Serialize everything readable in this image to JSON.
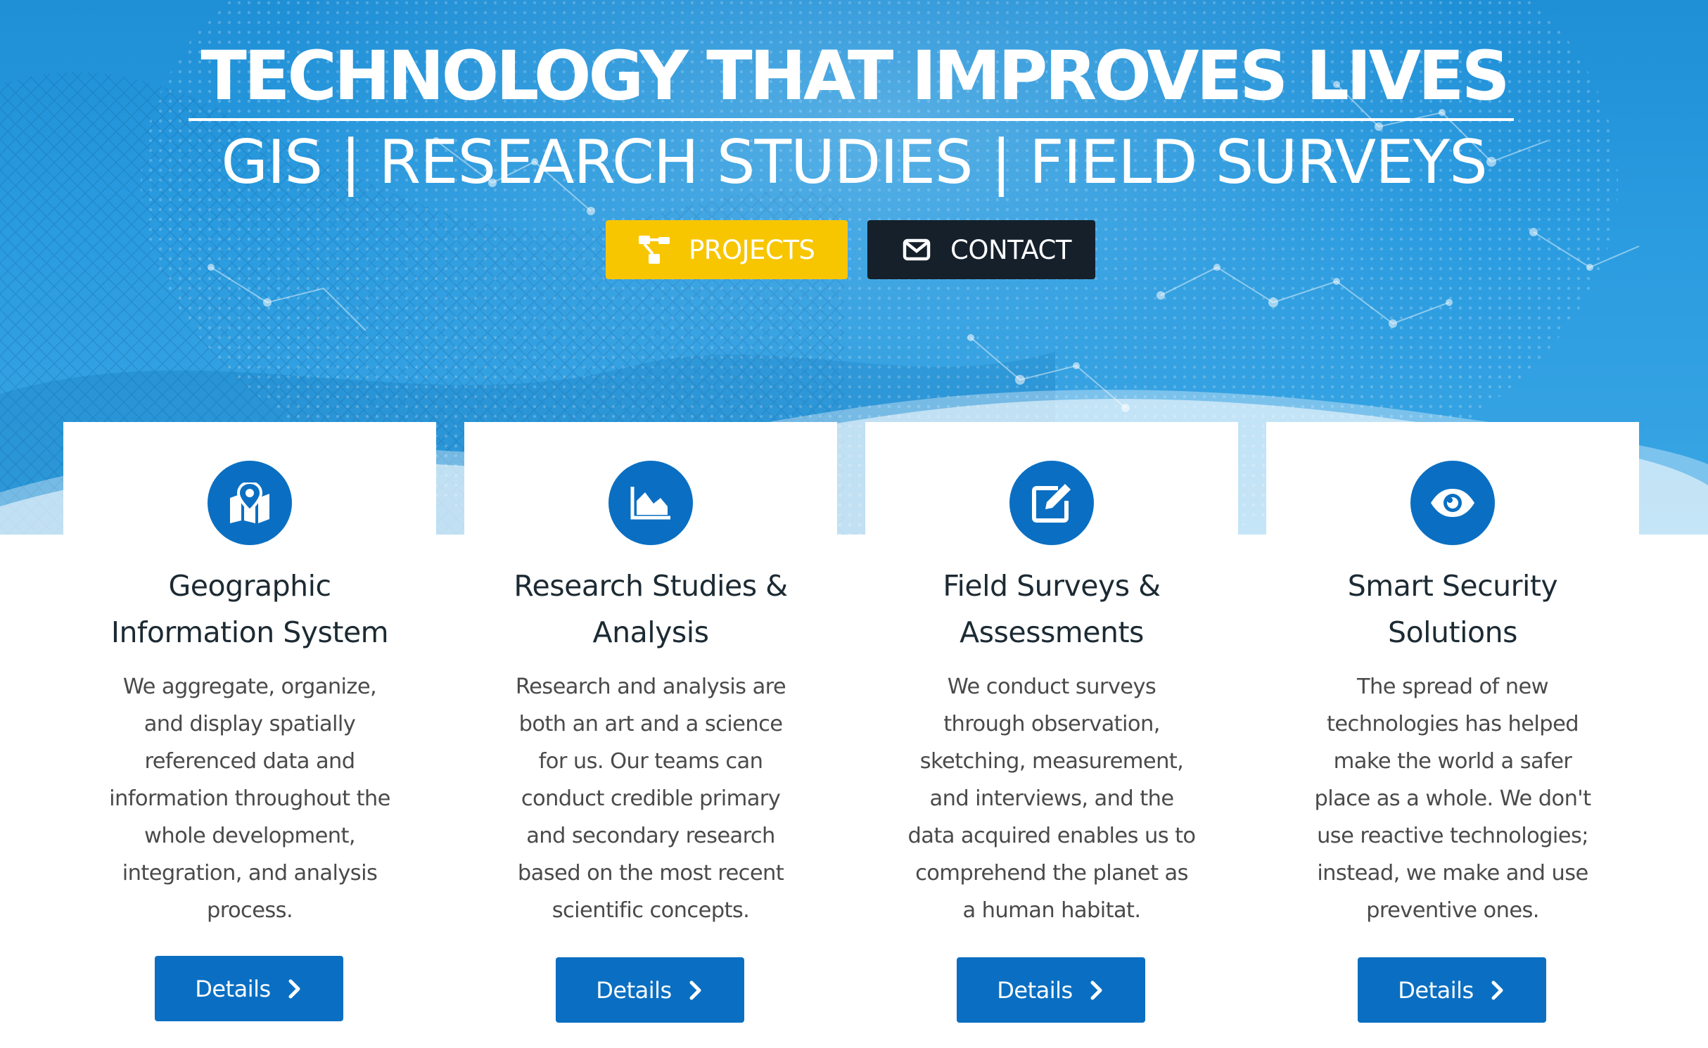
{
  "hero": {
    "title": "TECHNOLOGY THAT IMPROVES LIVES",
    "subtitle": "GIS | RESEARCH STUDIES | FIELD SURVEYS",
    "buttons": [
      {
        "label": "PROJECTS",
        "icon": "sitemap-icon",
        "color": "#f7c600"
      },
      {
        "label": "CONTACT",
        "icon": "envelope-icon",
        "color": "#15202b"
      }
    ]
  },
  "cards": [
    {
      "icon": "map-marker-icon",
      "title_lines": [
        "Geographic",
        "Information System"
      ],
      "text_lines": [
        "We aggregate, organize,",
        "and display spatially",
        "referenced data and",
        "information throughout the",
        "whole development,",
        "integration, and analysis",
        "process."
      ],
      "button": "Details"
    },
    {
      "icon": "area-chart-icon",
      "title_lines": [
        "Research Studies &",
        "Analysis"
      ],
      "text_lines": [
        "Research and analysis are",
        "both an art and a science",
        "for us. Our teams can",
        "conduct credible primary",
        "and secondary research",
        "based on the most recent",
        "scientific concepts."
      ],
      "button": "Details"
    },
    {
      "icon": "edit-icon",
      "title_lines": [
        "Field Surveys &",
        "Assessments"
      ],
      "text_lines": [
        "We conduct surveys",
        "through observation,",
        "sketching, measurement,",
        "and interviews, and the",
        "data acquired enables us to",
        "comprehend the planet as",
        "a human habitat."
      ],
      "button": "Details"
    },
    {
      "icon": "eye-icon",
      "title_lines": [
        "Smart Security",
        "Solutions"
      ],
      "text_lines": [
        "The spread of new",
        "technologies has helped",
        "make the world a safer",
        "place as a whole. We don't",
        "use reactive technologies;",
        "instead, we make and use",
        "preventive ones."
      ],
      "button": "Details"
    }
  ],
  "colors": {
    "hero_blue": "#2b9ce0",
    "accent_blue": "#0a6fc2",
    "projects_yellow": "#f7c600",
    "contact_dark": "#15202b",
    "heading_text": "#1c2a33",
    "body_text": "#4a4a4a"
  }
}
